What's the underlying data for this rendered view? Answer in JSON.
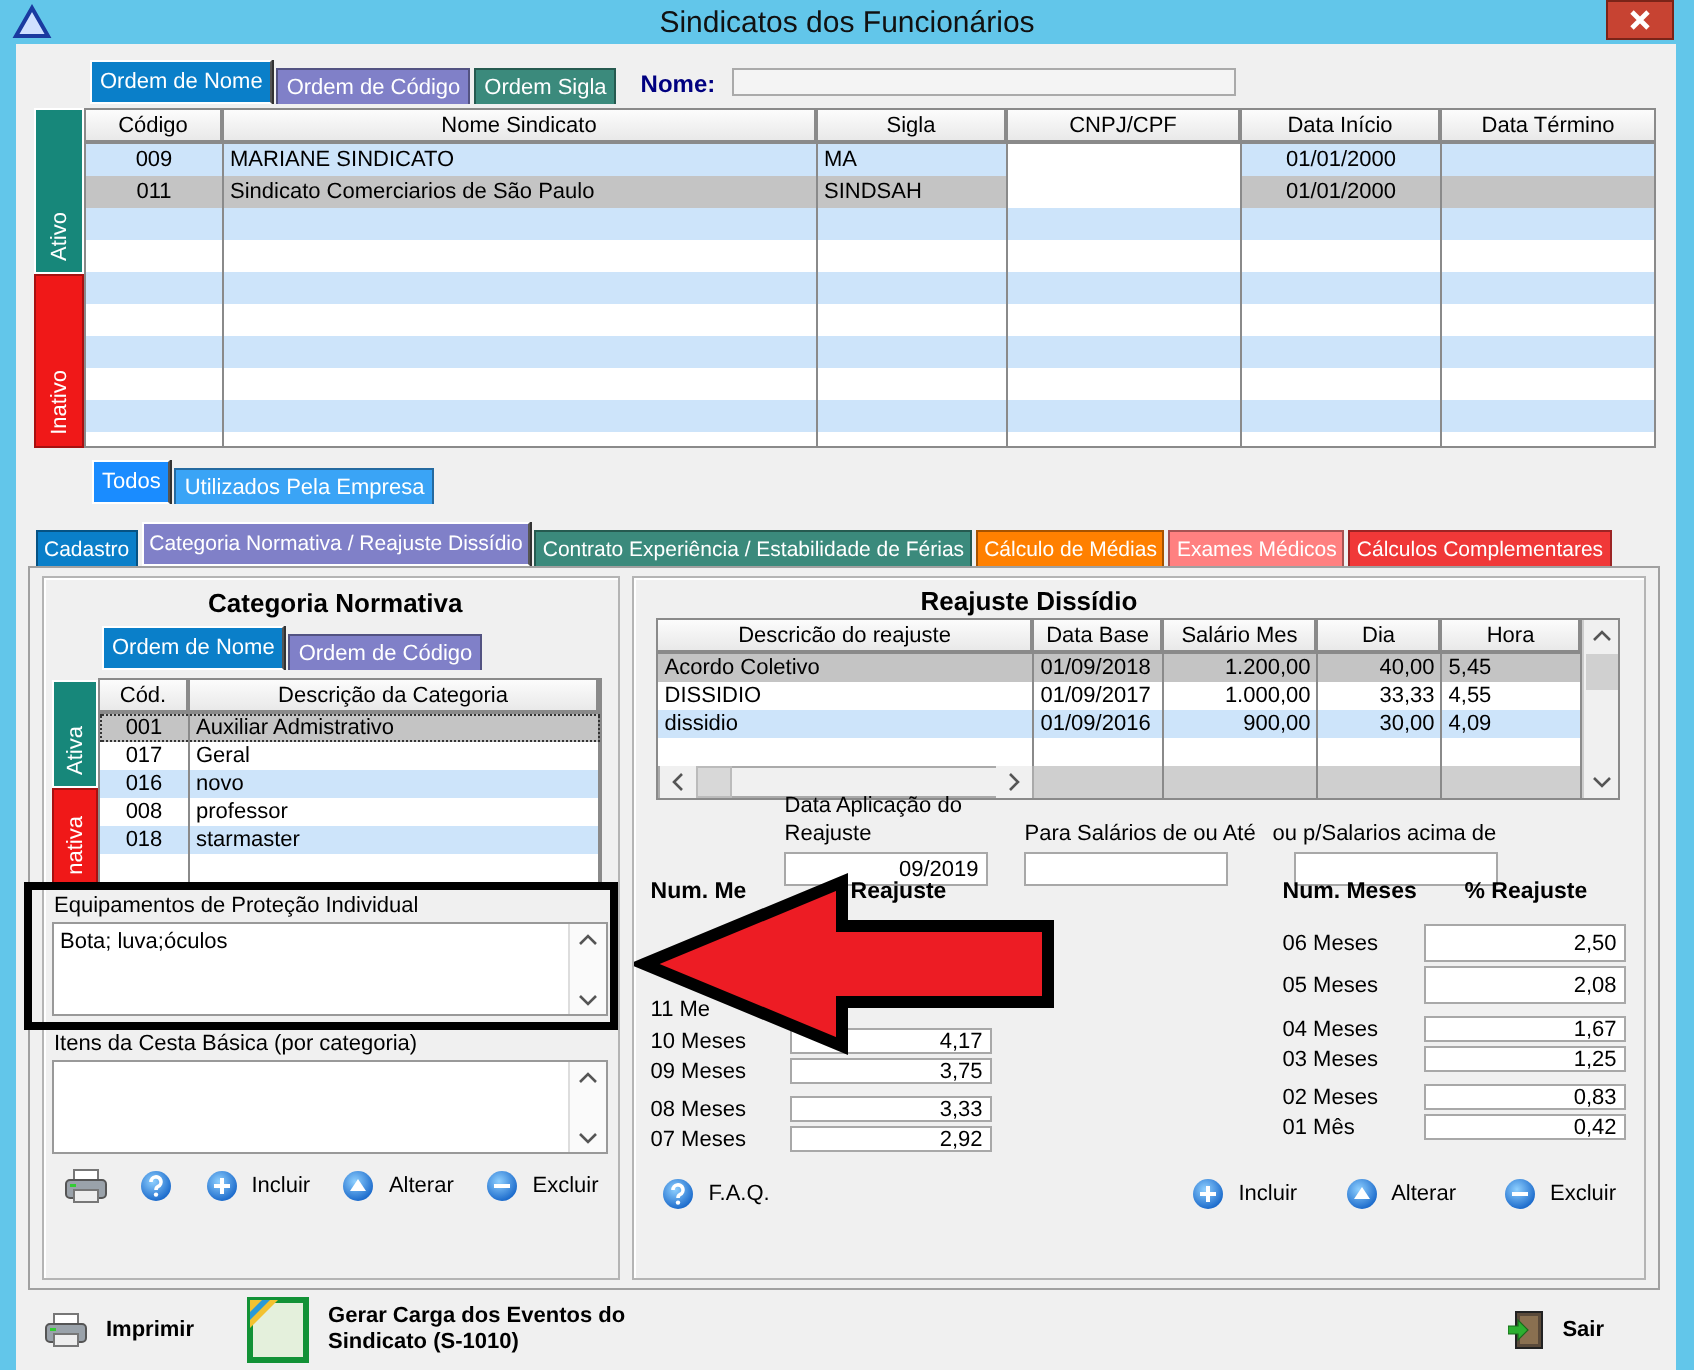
{
  "window": {
    "title": "Sindicatos dos Funcionários"
  },
  "sort_tabs": [
    {
      "label": "Ordem de Nome",
      "selected": true,
      "color": "#0a7fc9"
    },
    {
      "label": "Ordem de Código",
      "selected": false,
      "color": "#8080c8"
    },
    {
      "label": "Ordem Sigla",
      "selected": false,
      "color": "#3b8a7c"
    }
  ],
  "name_filter": {
    "label": "Nome:"
  },
  "status_tabs": [
    {
      "label": "Ativo",
      "selected": true,
      "color": "#17877a"
    },
    {
      "label": "Inativo",
      "selected": false,
      "color": "#f01818"
    }
  ],
  "unions_table": {
    "columns": [
      "Código",
      "Nome Sindicato",
      "Sigla",
      "CNPJ/CPF",
      "Data Início",
      "Data Término"
    ],
    "rows": [
      {
        "codigo": "009",
        "nome": "MARIANE SINDICATO",
        "sigla": "MA",
        "data_inicio": "01/01/2000",
        "selected": false
      },
      {
        "codigo": "011",
        "nome": "Sindicato Comerciarios de São Paulo",
        "sigla": "SINDSAH",
        "data_inicio": "01/01/2000",
        "selected": true
      }
    ]
  },
  "filter_tabs": [
    {
      "label": "Todos",
      "selected": true,
      "color": "#1a8cff"
    },
    {
      "label": "Utilizados Pela Empresa",
      "selected": false,
      "color": "#3aa4f6"
    }
  ],
  "main_tabs": [
    {
      "label": "Cadastro",
      "selected": false,
      "color": "#0a7fc9"
    },
    {
      "label": "Categoria Normativa / Reajuste Dissídio",
      "selected": true,
      "color": "#8080c8"
    },
    {
      "label": "Contrato Experiência / Estabilidade de Férias",
      "selected": false,
      "color": "#3b8a7c"
    },
    {
      "label": "Cálculo de Médias",
      "selected": false,
      "color": "#ff8000"
    },
    {
      "label": "Exames Médicos",
      "selected": false,
      "color": "#ff8080"
    },
    {
      "label": "Cálculos Complementares",
      "selected": false,
      "color": "#f03838"
    }
  ],
  "categoria": {
    "title": "Categoria Normativa",
    "sort_tabs": [
      {
        "label": "Ordem de Nome",
        "selected": true,
        "color": "#0a7fc9"
      },
      {
        "label": "Ordem de Código",
        "selected": false,
        "color": "#8080c8"
      }
    ],
    "status_tabs": [
      {
        "label": "Ativa",
        "selected": true,
        "color": "#17877a"
      },
      {
        "label": "nativa",
        "selected": false,
        "color": "#f01818"
      }
    ],
    "columns": [
      "Cód.",
      "Descrição da Categoria"
    ],
    "rows": [
      {
        "codigo": "001",
        "descricao": "Auxiliar Admistrativo",
        "selected": true
      },
      {
        "codigo": "017",
        "descricao": "Geral",
        "selected": false
      },
      {
        "codigo": "016",
        "descricao": "novo",
        "selected": false
      },
      {
        "codigo": "008",
        "descricao": "professor",
        "selected": false
      },
      {
        "codigo": "018",
        "descricao": "starmaster",
        "selected": false
      }
    ],
    "epi": {
      "label": "Equipamentos de Proteção Individual",
      "value": "Bota; luva;óculos"
    },
    "cesta": {
      "label": "Itens da Cesta Básica (por categoria)"
    },
    "actions": [
      {
        "kind": "print"
      },
      {
        "kind": "help"
      },
      {
        "kind": "add",
        "label": "Incluir"
      },
      {
        "kind": "edit",
        "label": "Alterar"
      },
      {
        "kind": "delete",
        "label": "Excluir"
      }
    ]
  },
  "reajuste": {
    "title": "Reajuste Dissídio",
    "columns": [
      "Descricão do reajuste",
      "Data Base",
      "Salário Mes",
      "Dia",
      "Hora"
    ],
    "rows": [
      {
        "descricao": "Acordo Coletivo",
        "data_base": "01/09/2018",
        "salario": "1.200,00",
        "dia": "40,00",
        "hora": "5,45",
        "selected": true
      },
      {
        "descricao": "DISSIDIO",
        "data_base": "01/09/2017",
        "salario": "1.000,00",
        "dia": "33,33",
        "hora": "4,55",
        "selected": false
      },
      {
        "descricao": "dissidio",
        "data_base": "01/09/2016",
        "salario": "900,00",
        "dia": "30,00",
        "hora": "4,09",
        "selected": false
      }
    ],
    "data_aplicacao": {
      "label": "Data Aplicação do Reajuste",
      "value": "09/2019"
    },
    "salarios_ate": {
      "label": "Para Salários de ou Até"
    },
    "salarios_acima": {
      "label": "ou p/Salarios acima de"
    },
    "left_headers": [
      "Num. Me",
      "Reajuste"
    ],
    "left_groups": [
      [
        {
          "label": "11 Me"
        }
      ],
      [
        {
          "label": "10 Meses",
          "value": "4,17"
        },
        {
          "label": "09 Meses",
          "value": "3,75"
        }
      ],
      [
        {
          "label": "08 Meses",
          "value": "3,33"
        },
        {
          "label": "07 Meses",
          "value": "2,92"
        }
      ]
    ],
    "right_headers": [
      "Num. Meses",
      "% Reajuste"
    ],
    "right_groups": [
      [
        {
          "label": "06 Meses",
          "value": "2,50"
        },
        {
          "label": "05 Meses",
          "value": "2,08"
        }
      ],
      [
        {
          "label": "04 Meses",
          "value": "1,67"
        },
        {
          "label": "03 Meses",
          "value": "1,25"
        }
      ],
      [
        {
          "label": "02 Meses",
          "value": "0,83"
        },
        {
          "label": "01 Mês",
          "value": "0,42"
        }
      ]
    ],
    "actions": [
      {
        "kind": "help",
        "label": "F.A.Q."
      },
      {
        "kind": "add",
        "label": "Incluir"
      },
      {
        "kind": "edit",
        "label": "Alterar"
      },
      {
        "kind": "delete",
        "label": "Excluir"
      }
    ]
  },
  "footer": [
    {
      "kind": "print",
      "label": "Imprimir"
    },
    {
      "kind": "export",
      "label": "Gerar Carga dos Eventos do Sindicato (S-1010)"
    },
    {
      "kind": "exit",
      "label": "Sair"
    }
  ]
}
